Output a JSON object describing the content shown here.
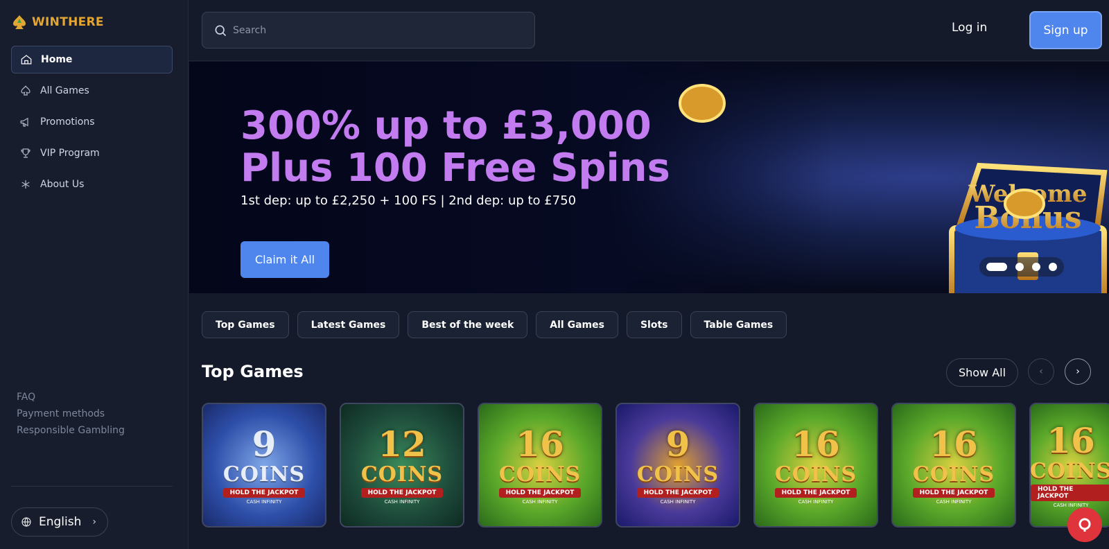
{
  "brand": {
    "name": "WINTHERE",
    "accent": "#e3a632"
  },
  "sidebar": {
    "items": [
      {
        "label": "Home",
        "icon": "home-icon",
        "active": true
      },
      {
        "label": "All Games",
        "icon": "spade-icon"
      },
      {
        "label": "Promotions",
        "icon": "megaphone-icon"
      },
      {
        "label": "VIP Program",
        "icon": "trophy-icon"
      },
      {
        "label": "About Us",
        "icon": "asterisk-icon"
      }
    ],
    "footer_links": [
      "FAQ",
      "Payment methods",
      "Responsible Gambling"
    ],
    "language": "English"
  },
  "header": {
    "search_placeholder": "Search",
    "login_label": "Log in",
    "signup_label": "Sign up",
    "accent_color": "#4e86ee"
  },
  "banner": {
    "title_line1": "300% up to £3,000",
    "title_line2": "Plus 100 Free Spins",
    "subtitle": "1st dep: up to £2,250 + 100 FS | 2nd dep: up to £750",
    "cta_label": "Claim it All",
    "art_text_1": "Welcome",
    "art_text_2": "Bonus",
    "slides": 4,
    "active_slide": 1
  },
  "categories": [
    "Top Games",
    "Latest Games",
    "Best of the week",
    "All Games",
    "Slots",
    "Table Games"
  ],
  "section": {
    "title": "Top Games",
    "show_all_label": "Show All",
    "prev_icon": "chevron-left-icon",
    "next_icon": "chevron-right-icon"
  },
  "games": [
    {
      "num": "9",
      "word": "COINS",
      "ribbon": "HOLD THE JACKPOT",
      "tag": "CASH INFINITY",
      "style": "g-silver"
    },
    {
      "num": "12",
      "word": "COINS",
      "ribbon": "HOLD THE JACKPOT",
      "tag": "CASH INFINITY",
      "style": "g-dark"
    },
    {
      "num": "16",
      "word": "COINS",
      "ribbon": "HOLD THE JACKPOT",
      "tag": "CASH INFINITY",
      "style": "g-green"
    },
    {
      "num": "9",
      "word": "COINS",
      "ribbon": "HOLD THE JACKPOT",
      "tag": "CASH INFINITY",
      "style": "g-blue"
    },
    {
      "num": "16",
      "word": "COINS",
      "ribbon": "HOLD THE JACKPOT",
      "tag": "CASH INFINITY",
      "style": "g-green"
    },
    {
      "num": "16",
      "word": "COINS",
      "ribbon": "HOLD THE JACKPOT",
      "tag": "CASH INFINITY",
      "style": "g-green"
    },
    {
      "num": "16",
      "word": "COINS",
      "ribbon": "HOLD THE JACKPOT",
      "tag": "CASH INFINITY",
      "style": "g-green"
    }
  ]
}
